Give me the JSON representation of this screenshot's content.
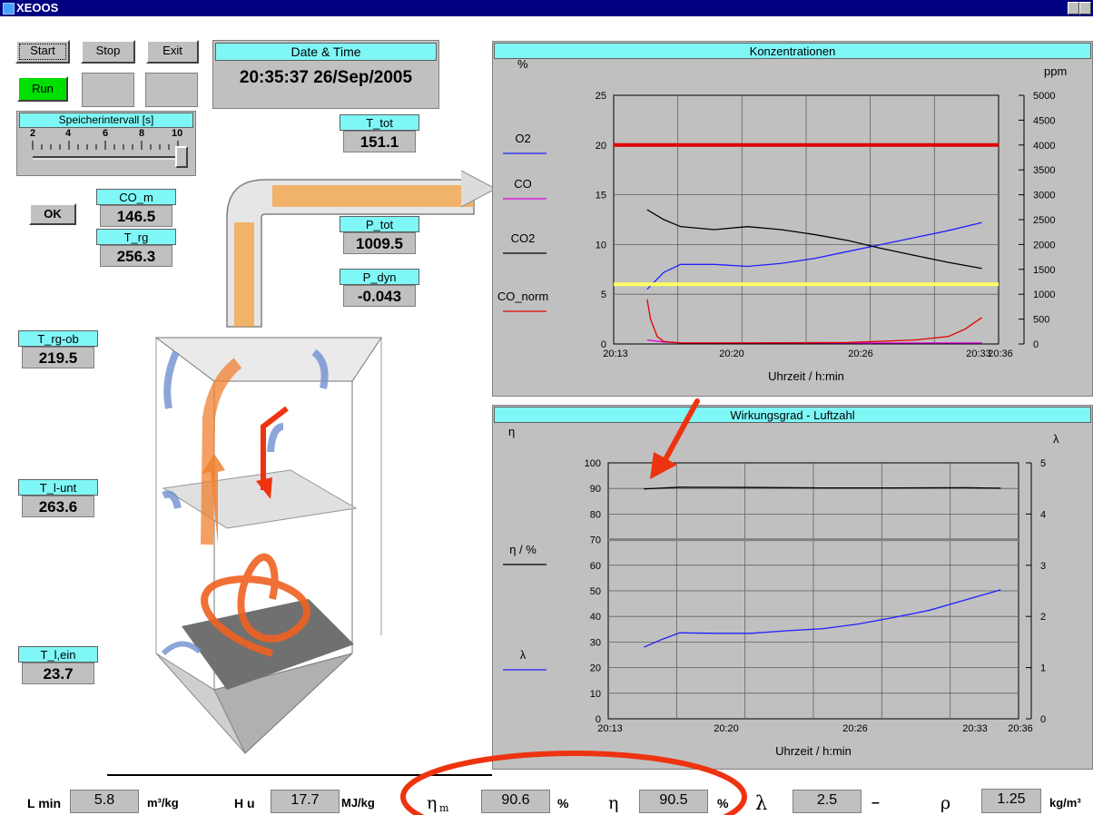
{
  "window": {
    "title": "XEOOS"
  },
  "controls": {
    "start_label": "Start",
    "stop_label": "Stop",
    "exit_label": "Exit",
    "run_label": "Run",
    "ok_label": "OK",
    "run_color": "#00e000"
  },
  "datetime": {
    "header": "Date & Time",
    "value": "20:35:37  26/Sep/2005"
  },
  "slider": {
    "header": "Speicherintervall [s]",
    "ticks": [
      "2",
      "4",
      "6",
      "8",
      "10"
    ],
    "min": 2,
    "max": 10,
    "value": 10
  },
  "gauges": {
    "t_tot": {
      "label": "T_tot",
      "value": "151.1"
    },
    "co_m": {
      "label": "CO_m",
      "value": "146.5"
    },
    "p_tot": {
      "label": "P_tot",
      "value": "1009.5"
    },
    "t_rg": {
      "label": "T_rg",
      "value": "256.3"
    },
    "p_dyn": {
      "label": "P_dyn",
      "value": "-0.043"
    },
    "t_rg_ob": {
      "label": "T_rg-ob",
      "value": "219.5"
    },
    "t_l_unt": {
      "label": "T_l-unt",
      "value": "263.6"
    },
    "t_l_ein": {
      "label": "T_l,ein",
      "value": "23.7"
    }
  },
  "bottom": {
    "lmin": {
      "label": "L min",
      "value": "5.8",
      "unit": "m³/kg"
    },
    "hu": {
      "label": "H u",
      "value": "17.7",
      "unit": "MJ/kg"
    },
    "eta_m": {
      "label": "η",
      "sub": "m",
      "value": "90.6",
      "unit": "%"
    },
    "eta": {
      "label": "η",
      "value": "90.5",
      "unit": "%"
    },
    "lambda": {
      "label": "λ",
      "value": "2.5",
      "unit": "–"
    },
    "rho": {
      "label": "ρ",
      "value": "1.25",
      "unit": "kg/m³"
    }
  },
  "annotation_color": "#ee3311",
  "chart_data": [
    {
      "type": "line",
      "title": "Konzentrationen",
      "xlabel": "Uhrzeit / h:min",
      "ylabel_left": "%",
      "ylabel_right": "ppm",
      "x_ticks": [
        "20:13",
        "20:20",
        "20:26",
        "20:33",
        "20:36"
      ],
      "x_range_min": [
        0,
        23
      ],
      "left_ticks": [
        "0",
        "5",
        "10",
        "15",
        "20",
        "25"
      ],
      "ylim_left": [
        0,
        25
      ],
      "right_ticks": [
        "0",
        "500",
        "1000",
        "1500",
        "2000",
        "2500",
        "3000",
        "3500",
        "4000",
        "4500",
        "5000"
      ],
      "ylim_right": [
        0,
        5000
      ],
      "grid": true,
      "legend": [
        "O2",
        "CO",
        "CO2",
        "CO_norm"
      ],
      "series": [
        {
          "name": "O2",
          "color": "#2020ff",
          "axis": "left",
          "x": [
            2,
            3,
            4,
            6,
            8,
            10,
            12,
            14,
            16,
            18,
            20,
            22
          ],
          "y": [
            5.5,
            7.2,
            8.0,
            8.0,
            7.8,
            8.1,
            8.6,
            9.3,
            10.0,
            10.7,
            11.4,
            12.2
          ]
        },
        {
          "name": "CO",
          "color": "#e000e0",
          "axis": "right",
          "x": [
            2,
            3,
            4,
            22
          ],
          "y": [
            80,
            40,
            20,
            20
          ]
        },
        {
          "name": "CO2",
          "color": "#000000",
          "axis": "left",
          "x": [
            2,
            3,
            4,
            6,
            8,
            10,
            12,
            14,
            16,
            18,
            20,
            22
          ],
          "y": [
            13.5,
            12.5,
            11.8,
            11.5,
            11.8,
            11.5,
            11.0,
            10.4,
            9.6,
            8.9,
            8.2,
            7.6
          ]
        },
        {
          "name": "CO_norm",
          "color": "#e00000",
          "axis": "right",
          "x": [
            2,
            2.2,
            2.6,
            3,
            4,
            8,
            14,
            18,
            20,
            21,
            22
          ],
          "y": [
            900,
            500,
            150,
            50,
            20,
            20,
            30,
            80,
            150,
            300,
            530
          ]
        },
        {
          "name": "",
          "color": "#e00000",
          "axis": "left",
          "x": [
            0,
            23
          ],
          "y": [
            20,
            20
          ]
        },
        {
          "name": "",
          "color": "#ffff60",
          "axis": "left",
          "x": [
            0,
            23
          ],
          "y": [
            6,
            6
          ]
        }
      ]
    },
    {
      "type": "line",
      "title": "Wirkungsgrad - Luftzahl",
      "xlabel": "Uhrzeit / h:min",
      "ylabel_left": "η",
      "ylabel_right": "λ",
      "x_ticks": [
        "20:13",
        "20:20",
        "20:26",
        "20:33",
        "20:36"
      ],
      "x_range_min": [
        0,
        23
      ],
      "left_ticks": [
        "0",
        "10",
        "20",
        "30",
        "40",
        "50",
        "60",
        "70",
        "80",
        "90",
        "100"
      ],
      "ylim_left": [
        0,
        100
      ],
      "right_ticks": [
        "0",
        "1",
        "2",
        "3",
        "4",
        "5"
      ],
      "ylim_right": [
        0,
        5
      ],
      "grid": true,
      "legend": [
        "η / %",
        "λ"
      ],
      "series": [
        {
          "name": "η / %",
          "color": "#000000",
          "axis": "left",
          "x": [
            2,
            4,
            8,
            12,
            16,
            20,
            22
          ],
          "y": [
            89.8,
            90.5,
            90.4,
            90.2,
            90.2,
            90.3,
            90.1
          ]
        },
        {
          "name": "λ",
          "color": "#2020ff",
          "axis": "right",
          "x": [
            2,
            3,
            4,
            6,
            8,
            10,
            12,
            14,
            16,
            18,
            20,
            22
          ],
          "y": [
            1.4,
            1.55,
            1.68,
            1.67,
            1.67,
            1.72,
            1.76,
            1.85,
            1.98,
            2.12,
            2.32,
            2.52
          ]
        },
        {
          "name": "",
          "color": "#808080",
          "axis": "left",
          "x": [
            0,
            23
          ],
          "y": [
            70,
            70
          ]
        }
      ]
    }
  ]
}
